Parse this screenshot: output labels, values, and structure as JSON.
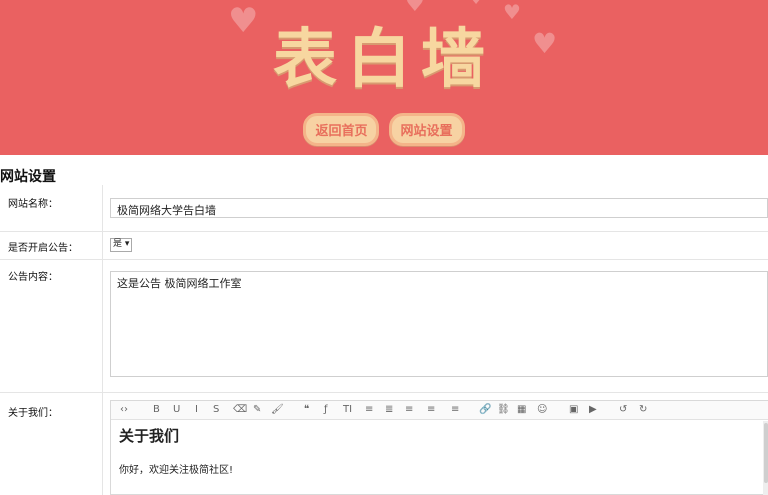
{
  "header": {
    "title": "表白墙",
    "buttons": [
      "返回首页",
      "网站设置"
    ]
  },
  "section": {
    "title": "网站设置"
  },
  "form": {
    "site_name": {
      "label": "网站名称：",
      "value": "极简网络大学告白墙"
    },
    "announcement_toggle": {
      "label": "是否开启公告：",
      "selected": "是"
    },
    "announcement_content": {
      "label": "公告内容：",
      "value": "这是公告 极简网络工作室"
    },
    "about": {
      "label": "关于我们：",
      "heading": "关于我们",
      "body": "你好，欢迎关注极简社区!"
    }
  },
  "editor_toolbar_icons": [
    "code",
    "bold",
    "underline",
    "italic",
    "strikethrough",
    "eraser",
    "brush",
    "paint",
    "quote",
    "font",
    "text-size",
    "list-unordered",
    "list-ordered",
    "align-left",
    "align-center",
    "align-right",
    "link",
    "unlink",
    "table",
    "emoji",
    "image",
    "video",
    "undo",
    "redo"
  ],
  "editor_toolbar_glyphs": [
    "‹›",
    "B",
    "U",
    "I",
    "S",
    "⌫",
    "✎",
    "🖌",
    "❝",
    "ƒ",
    "TI",
    "≡",
    "≣",
    "≡",
    "≡",
    "≡",
    "🔗",
    "⛓",
    "▦",
    "☺",
    "▣",
    "▶",
    "↺",
    "↻"
  ],
  "colors": {
    "header_bg": "#ea6161",
    "title": "#f7d7a0",
    "pill_bg": "#f7d2a3",
    "pill_text": "#e86f5c"
  }
}
